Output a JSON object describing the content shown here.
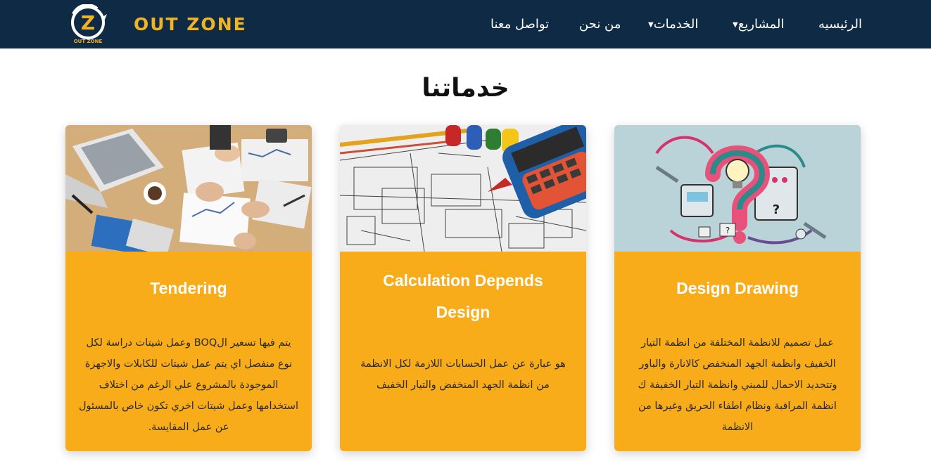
{
  "brand": {
    "logo_letter": "Z",
    "logo_caption": "OUT ZONE",
    "name": "OUT ZONE"
  },
  "nav": {
    "home": "الرئيسيه",
    "projects": "المشاريع",
    "services": "الخدمات",
    "about": "من نحن",
    "contact": "تواصل معنا",
    "caret": "▼"
  },
  "section": {
    "title": "خدماتنا"
  },
  "cards": [
    {
      "title": "Tendering",
      "description": "يتم فيها تسعير الBOQ وعمل شيتات دراسة لكل نوع منفصل اي يتم عمل شيتات للكابلات والاجهزة الموجودة بالمشروع علي الرغم من اختلاف استخدامها وعمل شيتات اخري تكون خاص بالمسئول عن عمل المقايسة.",
      "image_icon": "business-meeting-photo"
    },
    {
      "title": "Calculation Depends Design",
      "description": "هو عبارة عن عمل الحسابات اللازمة لكل الانظمة من انظمة الجهد المنخفض والتيار الخفيف",
      "image_icon": "blueprint-calculator-photo"
    },
    {
      "title": "Design Drawing",
      "description": "عمل تصميم للانظمة المختلفة من انظمة التيار الخفيف وانظمة الجهد المنخفض كالانارة والباور وتتحديد الاحمال للمبني وانظمة التيار الخفيفة ك انظمة المراقبة ونظام اطفاء الحريق وغيرها من الانظمة",
      "image_icon": "question-mark-circuit-illustration"
    }
  ],
  "colors": {
    "navbar": "#0f2a44",
    "brand_gold": "#f0b323",
    "card_bg": "#f9ac19",
    "white": "#ffffff"
  }
}
